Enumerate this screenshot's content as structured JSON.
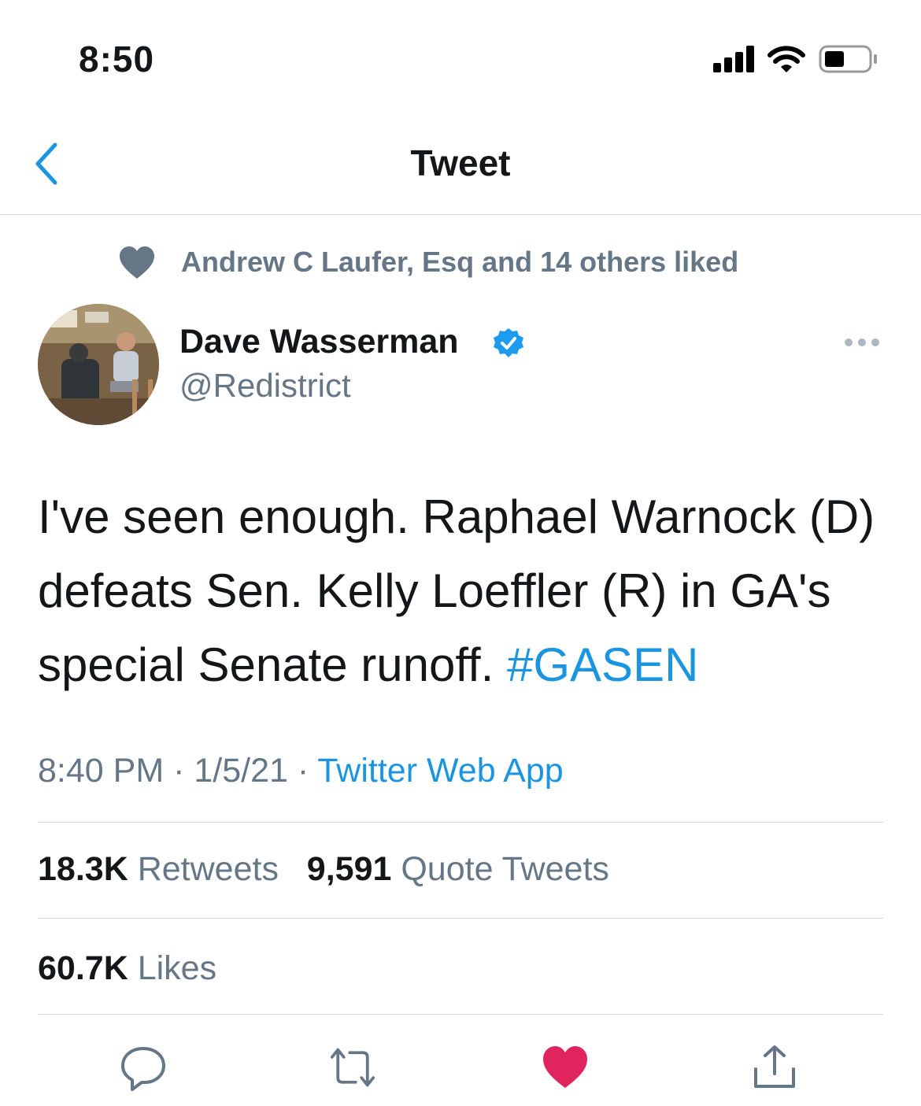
{
  "status_bar": {
    "time": "8:50"
  },
  "nav": {
    "title": "Tweet"
  },
  "social_context": {
    "text": "Andrew C Laufer, Esq and 14 others liked"
  },
  "author": {
    "name": "Dave Wasserman",
    "handle": "@Redistrict"
  },
  "tweet": {
    "text": "I've seen enough. Raphael Warnock (D) defeats Sen. Kelly Loeffler (R) in GA's special Senate runoff.",
    "hashtag": "#GASEN",
    "time": "8:40 PM",
    "date": "1/5/21",
    "source": "Twitter Web App"
  },
  "stats": {
    "retweets_count": "18.3K",
    "retweets_label": "Retweets",
    "quotes_count": "9,591",
    "quotes_label": "Quote Tweets",
    "likes_count": "60.7K",
    "likes_label": "Likes"
  },
  "colors": {
    "accent": "#1b95e0",
    "secondary_text": "#657786",
    "like_red": "#e0245e",
    "divider": "#ced5dc"
  },
  "icons": [
    "signal-icon",
    "wifi-icon",
    "battery-icon",
    "back-chevron-icon",
    "heart-icon",
    "verified-badge-icon",
    "more-icon",
    "reply-icon",
    "retweet-icon",
    "like-icon",
    "share-icon"
  ]
}
